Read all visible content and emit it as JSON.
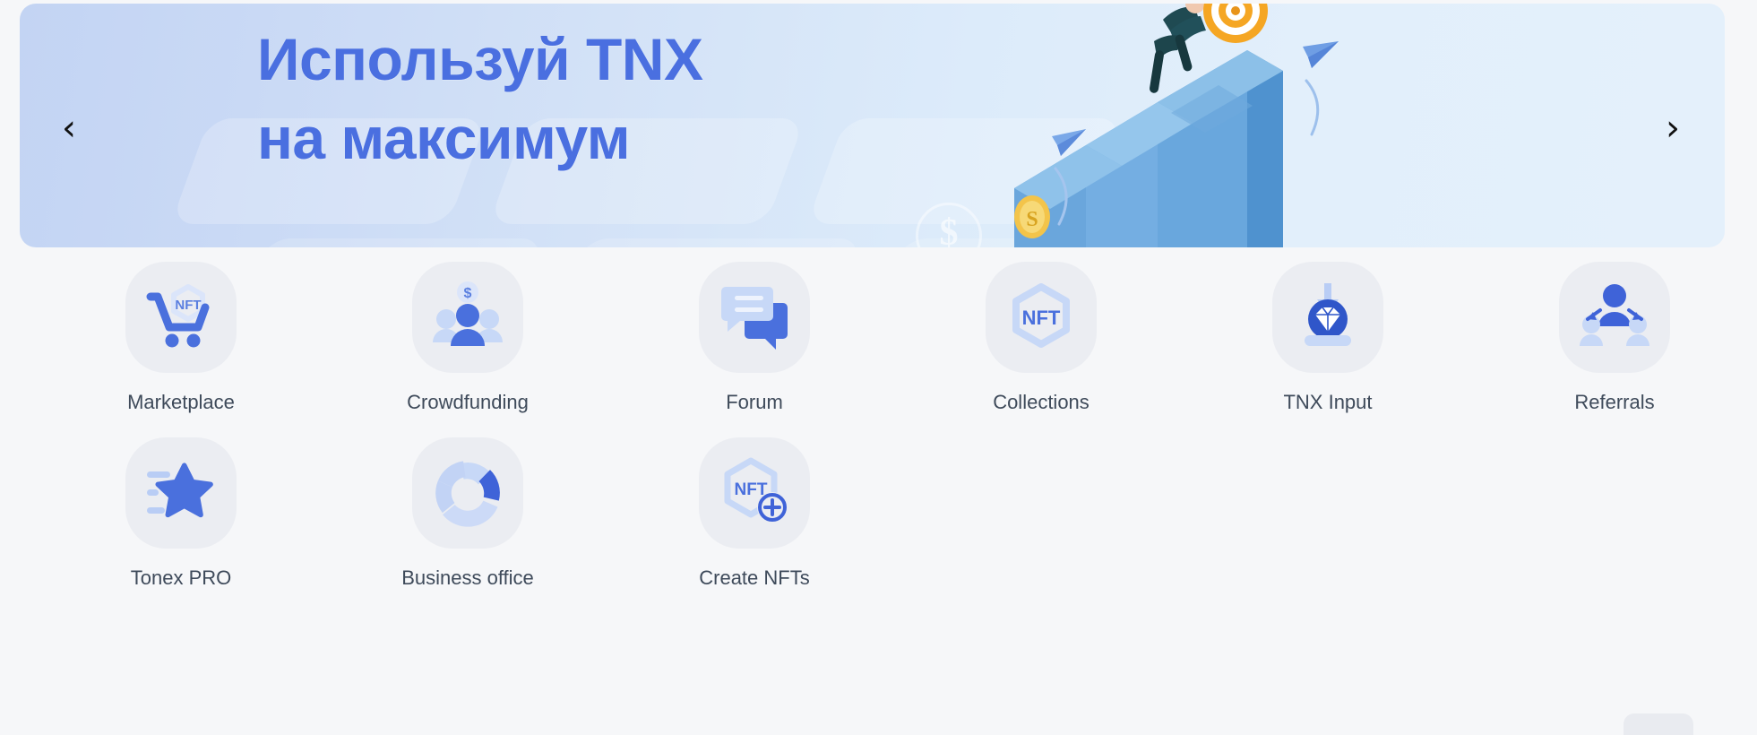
{
  "banner": {
    "title": "Используй TNX\nна максимум",
    "prev_label": "‹",
    "next_label": "›",
    "prev_icon": "chevron-left-icon",
    "next_icon": "chevron-right-icon",
    "coin_glyph": "$",
    "gradient_from": "#c3d4f3",
    "gradient_to": "#e4f0fb",
    "title_color": "#4a6fe0"
  },
  "colors": {
    "page_bg": "#f6f7f9",
    "tile_bg": "#ebedf2",
    "accent_blue": "#4a70dd",
    "light_blue": "#c2d3f5",
    "label": "#3e4a5a"
  },
  "grid": {
    "items": [
      {
        "label": "Marketplace",
        "icon": "nft-cart-icon"
      },
      {
        "label": "Crowdfunding",
        "icon": "people-dollar-icon"
      },
      {
        "label": "Forum",
        "icon": "chat-bubbles-icon"
      },
      {
        "label": "Collections",
        "icon": "nft-hexagon-icon"
      },
      {
        "label": "TNX Input",
        "icon": "diamond-download-icon"
      },
      {
        "label": "Referrals",
        "icon": "referral-people-icon"
      },
      {
        "label": "Tonex PRO",
        "icon": "star-list-icon"
      },
      {
        "label": "Business office",
        "icon": "donut-chart-icon"
      },
      {
        "label": "Create NFTs",
        "icon": "nft-plus-icon"
      }
    ],
    "nft_text": "NFT"
  }
}
